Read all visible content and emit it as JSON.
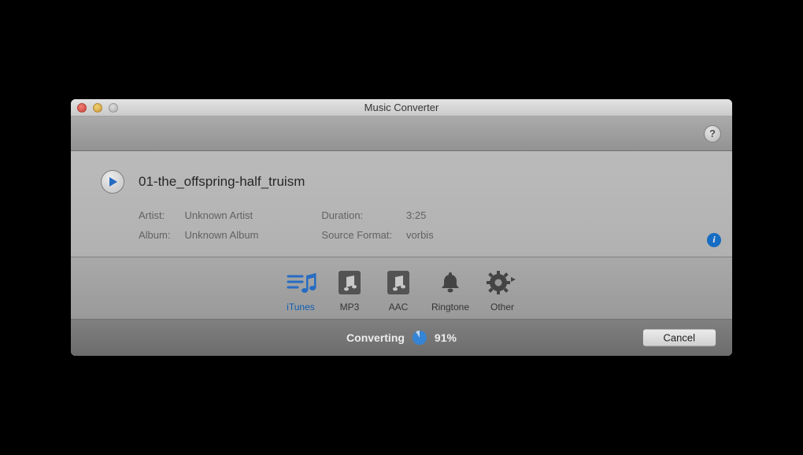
{
  "window": {
    "title": "Music Converter"
  },
  "track": {
    "name": "01-the_offspring-half_truism",
    "artist_label": "Artist:",
    "artist": "Unknown Artist",
    "album_label": "Album:",
    "album": "Unknown Album",
    "duration_label": "Duration:",
    "duration": "3:25",
    "source_format_label": "Source Format:",
    "source_format": "vorbis"
  },
  "formats": {
    "itunes": "iTunes",
    "mp3": "MP3",
    "aac": "AAC",
    "ringtone": "Ringtone",
    "other": "Other"
  },
  "status": {
    "label": "Converting",
    "percent_text": "91%",
    "percent_value": 91
  },
  "buttons": {
    "cancel": "Cancel",
    "help": "?"
  }
}
